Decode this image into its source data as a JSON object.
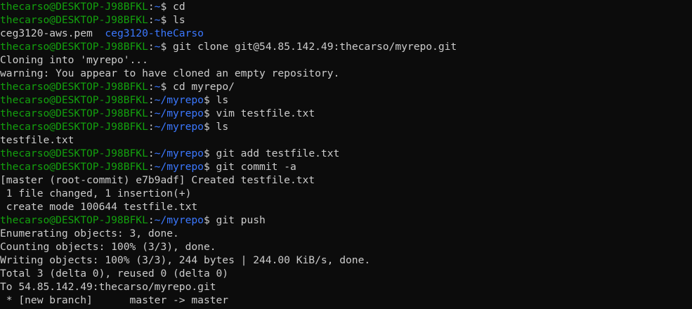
{
  "colors": {
    "background": "#0c0c0c",
    "text": "#cccccc",
    "prompt_user": "#13a10e",
    "prompt_path": "#3b78ff"
  },
  "prompt": {
    "user_host": "thecarso@DESKTOP-J98BFKL",
    "sep": ":"
  },
  "lines": [
    [
      {
        "t": "thecarso@DESKTOP-J98BFKL",
        "c": "g"
      },
      {
        "t": ":",
        "c": "w"
      },
      {
        "t": "~",
        "c": "b"
      },
      {
        "t": "$ cd",
        "c": "w"
      }
    ],
    [
      {
        "t": "thecarso@DESKTOP-J98BFKL",
        "c": "g"
      },
      {
        "t": ":",
        "c": "w"
      },
      {
        "t": "~",
        "c": "b"
      },
      {
        "t": "$ ls",
        "c": "w"
      }
    ],
    [
      {
        "t": "ceg3120-aws.pem  ",
        "c": "w"
      },
      {
        "t": "ceg3120-theCarso",
        "c": "b"
      }
    ],
    [
      {
        "t": "thecarso@DESKTOP-J98BFKL",
        "c": "g"
      },
      {
        "t": ":",
        "c": "w"
      },
      {
        "t": "~",
        "c": "b"
      },
      {
        "t": "$ git clone git@54.85.142.49:thecarso/myrepo.git",
        "c": "w"
      }
    ],
    [
      {
        "t": "Cloning into 'myrepo'...",
        "c": "w"
      }
    ],
    [
      {
        "t": "warning: You appear to have cloned an empty repository.",
        "c": "w"
      }
    ],
    [
      {
        "t": "thecarso@DESKTOP-J98BFKL",
        "c": "g"
      },
      {
        "t": ":",
        "c": "w"
      },
      {
        "t": "~",
        "c": "b"
      },
      {
        "t": "$ cd myrepo/",
        "c": "w"
      }
    ],
    [
      {
        "t": "thecarso@DESKTOP-J98BFKL",
        "c": "g"
      },
      {
        "t": ":",
        "c": "w"
      },
      {
        "t": "~/myrepo",
        "c": "b"
      },
      {
        "t": "$ ls",
        "c": "w"
      }
    ],
    [
      {
        "t": "thecarso@DESKTOP-J98BFKL",
        "c": "g"
      },
      {
        "t": ":",
        "c": "w"
      },
      {
        "t": "~/myrepo",
        "c": "b"
      },
      {
        "t": "$ vim testfile.txt",
        "c": "w"
      }
    ],
    [
      {
        "t": "thecarso@DESKTOP-J98BFKL",
        "c": "g"
      },
      {
        "t": ":",
        "c": "w"
      },
      {
        "t": "~/myrepo",
        "c": "b"
      },
      {
        "t": "$ ls",
        "c": "w"
      }
    ],
    [
      {
        "t": "testfile.txt",
        "c": "w"
      }
    ],
    [
      {
        "t": "thecarso@DESKTOP-J98BFKL",
        "c": "g"
      },
      {
        "t": ":",
        "c": "w"
      },
      {
        "t": "~/myrepo",
        "c": "b"
      },
      {
        "t": "$ git add testfile.txt",
        "c": "w"
      }
    ],
    [
      {
        "t": "thecarso@DESKTOP-J98BFKL",
        "c": "g"
      },
      {
        "t": ":",
        "c": "w"
      },
      {
        "t": "~/myrepo",
        "c": "b"
      },
      {
        "t": "$ git commit -a",
        "c": "w"
      }
    ],
    [
      {
        "t": "[master (root-commit) e7b9adf] Created testfile.txt",
        "c": "w"
      }
    ],
    [
      {
        "t": " 1 file changed, 1 insertion(+)",
        "c": "w"
      }
    ],
    [
      {
        "t": " create mode 100644 testfile.txt",
        "c": "w"
      }
    ],
    [
      {
        "t": "thecarso@DESKTOP-J98BFKL",
        "c": "g"
      },
      {
        "t": ":",
        "c": "w"
      },
      {
        "t": "~/myrepo",
        "c": "b"
      },
      {
        "t": "$ git push",
        "c": "w"
      }
    ],
    [
      {
        "t": "Enumerating objects: 3, done.",
        "c": "w"
      }
    ],
    [
      {
        "t": "Counting objects: 100% (3/3), done.",
        "c": "w"
      }
    ],
    [
      {
        "t": "Writing objects: 100% (3/3), 244 bytes | 244.00 KiB/s, done.",
        "c": "w"
      }
    ],
    [
      {
        "t": "Total 3 (delta 0), reused 0 (delta 0)",
        "c": "w"
      }
    ],
    [
      {
        "t": "To 54.85.142.49:thecarso/myrepo.git",
        "c": "w"
      }
    ],
    [
      {
        "t": " * [new branch]      master -> master",
        "c": "w"
      }
    ]
  ]
}
